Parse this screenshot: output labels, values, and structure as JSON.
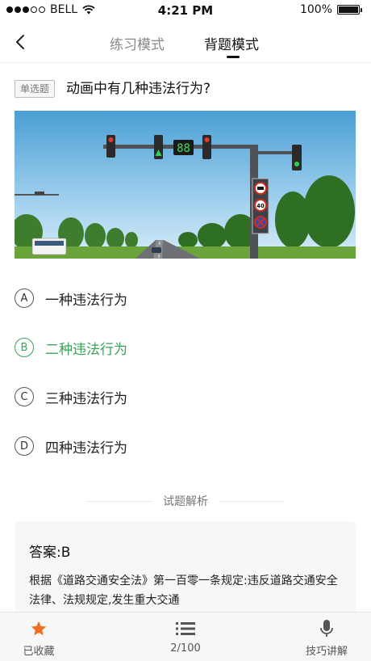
{
  "status_bar": {
    "carrier": "BELL",
    "time": "4:21 PM",
    "battery": "100%",
    "battery_level": 1.0
  },
  "header": {
    "back_icon": "chevron-left-icon",
    "tabs": [
      {
        "label": "练习模式",
        "active": false
      },
      {
        "label": "背题模式",
        "active": true
      }
    ]
  },
  "question": {
    "type_badge": "单选题",
    "text": "动画中有几种违法行为?",
    "image": {
      "signal_countdown": "88",
      "speed_limit": "40"
    }
  },
  "options": [
    {
      "letter": "A",
      "label": "一种违法行为",
      "correct": false
    },
    {
      "letter": "B",
      "label": "二种违法行为",
      "correct": true
    },
    {
      "letter": "C",
      "label": "三种违法行为",
      "correct": false
    },
    {
      "letter": "D",
      "label": "四种违法行为",
      "correct": false
    }
  ],
  "analysis": {
    "title": "试题解析",
    "answer": "答案:B",
    "explanation": "根据《道路交通安全法》第一百零一条规定:违反道路交通安全法律、法规规定,发生重大交通"
  },
  "bottom_bar": {
    "favorite": {
      "label": "已收藏",
      "icon": "star-icon",
      "color": "#f36c21"
    },
    "progress": {
      "label": "2/100",
      "icon": "list-icon"
    },
    "tips": {
      "label": "技巧讲解",
      "icon": "microphone-icon"
    }
  },
  "colors": {
    "correct": "#3aa35a",
    "favorite": "#f36c21"
  }
}
